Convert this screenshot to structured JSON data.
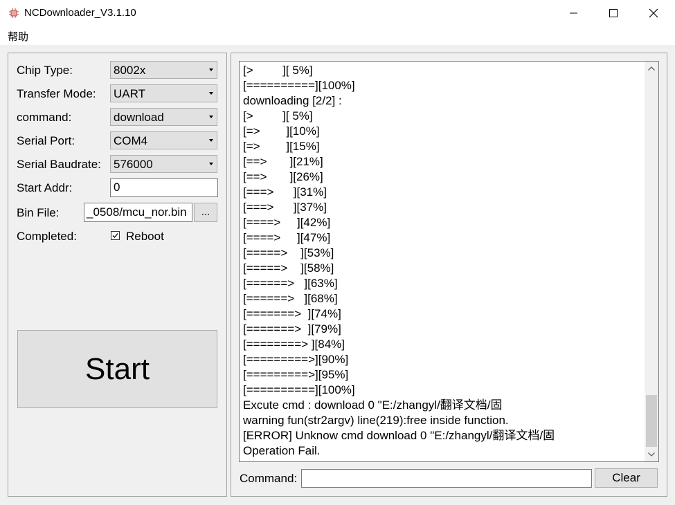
{
  "window": {
    "title": "NCDownloader_V3.1.10"
  },
  "menu": {
    "help": "帮助"
  },
  "form": {
    "chip_type_label": "Chip Type:",
    "chip_type_value": "8002x",
    "transfer_mode_label": "Transfer Mode:",
    "transfer_mode_value": "UART",
    "command_label": "command:",
    "command_value": "download",
    "serial_port_label": "Serial Port:",
    "serial_port_value": "COM4",
    "baudrate_label": "Serial Baudrate:",
    "baudrate_value": "576000",
    "start_addr_label": "Start Addr:",
    "start_addr_value": "0",
    "bin_file_label": "Bin File:",
    "bin_file_value": "_0508/mcu_nor.bin",
    "browse_label": "...",
    "completed_label": "Completed:",
    "reboot_label": "Reboot",
    "reboot_checked": true,
    "start_label": "Start"
  },
  "log": {
    "lines": [
      "[>         ][ 5%]",
      "[==========][100%]",
      "downloading [2/2] :",
      "[>         ][ 5%]",
      "[=>        ][10%]",
      "[=>        ][15%]",
      "[==>       ][21%]",
      "[==>       ][26%]",
      "[===>      ][31%]",
      "[===>      ][37%]",
      "[====>     ][42%]",
      "[====>     ][47%]",
      "[=====>    ][53%]",
      "[=====>    ][58%]",
      "[======>   ][63%]",
      "[======>   ][68%]",
      "[=======>  ][74%]",
      "[=======>  ][79%]",
      "[========> ][84%]",
      "[=========>][90%]",
      "[=========>][95%]",
      "[==========][100%]",
      "Excute cmd : download 0 \"E:/zhangyl/翻译文档/固",
      "warning fun(str2argv) line(219):free inside function.",
      "[ERROR] Unknow cmd download 0 \"E:/zhangyl/翻译文档/固",
      "Operation Fail."
    ]
  },
  "command_bar": {
    "label": "Command:",
    "value": "",
    "clear_label": "Clear"
  }
}
